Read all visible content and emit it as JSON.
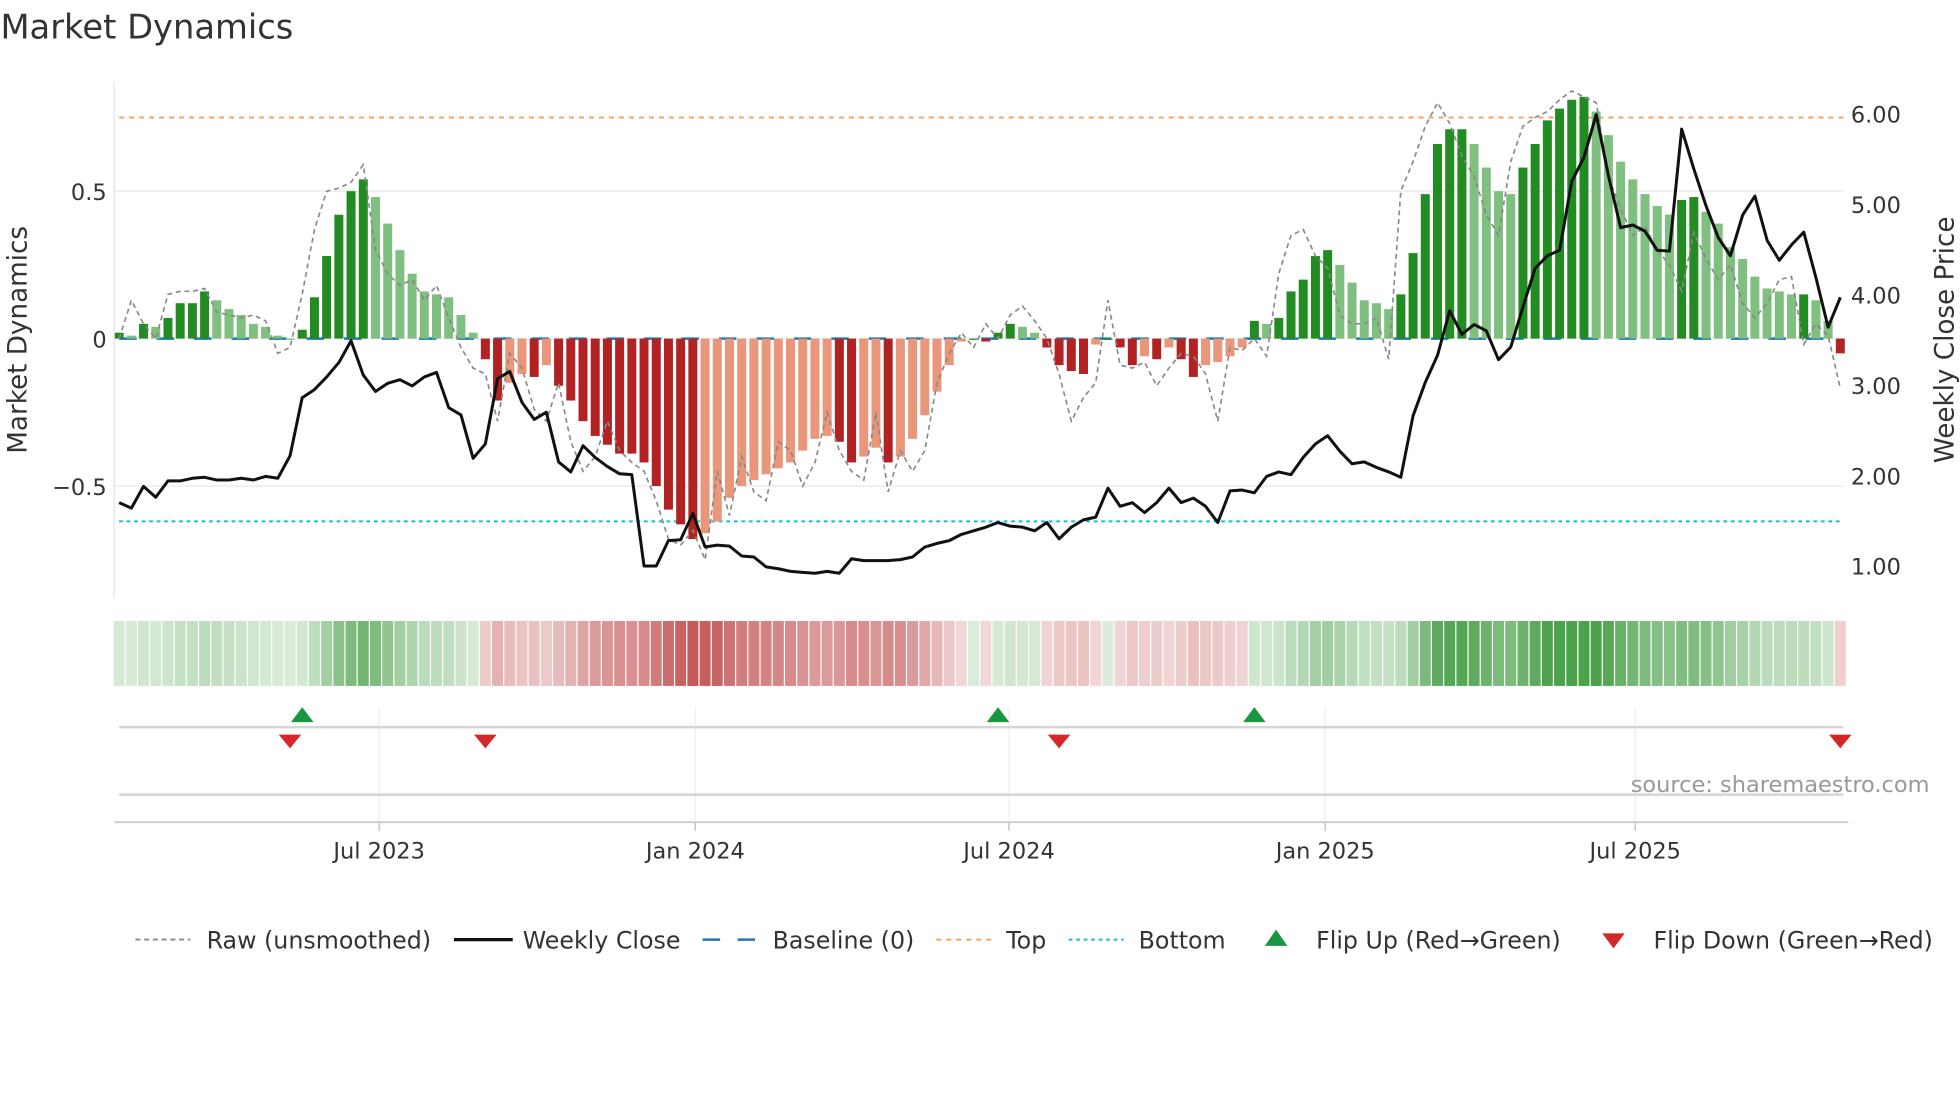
{
  "chart_data": {
    "type": "bar",
    "title": "Market Dynamics",
    "ylabel_left": "Market Dynamics",
    "ylabel_right": "Weekly Close Price",
    "source": "source: sharemaestro.com",
    "x_unit": "week index",
    "x_ticks": [
      {
        "label": "Jul 2023",
        "week": 21.3
      },
      {
        "label": "Jan 2024",
        "week": 47.2
      },
      {
        "label": "Jul 2024",
        "week": 72.9
      },
      {
        "label": "Jan 2025",
        "week": 98.8
      },
      {
        "label": "Jul 2025",
        "week": 124.2
      }
    ],
    "left_axis": {
      "ylim": [
        -0.88,
        0.88
      ],
      "ticks": [
        {
          "v": 0.5,
          "label": "0.5"
        },
        {
          "v": 0,
          "label": "0"
        },
        {
          "v": -0.5,
          "label": "−0.5"
        }
      ]
    },
    "right_axis": {
      "ylim": [
        0.5,
        6.5
      ],
      "ticks": [
        {
          "v": 6,
          "label": "6.00"
        },
        {
          "v": 5,
          "label": "5.00"
        },
        {
          "v": 4,
          "label": "4.00"
        },
        {
          "v": 3,
          "label": "3.00"
        },
        {
          "v": 2,
          "label": "2.00"
        },
        {
          "v": 1,
          "label": "1.00"
        }
      ]
    },
    "top_level": 0.75,
    "bottom_level": -0.62,
    "baseline": 0,
    "series": [
      {
        "name": "Market Dynamics (smoothed)",
        "values": [
          0.02,
          0.01,
          0.05,
          0.04,
          0.07,
          0.12,
          0.12,
          0.16,
          0.13,
          0.1,
          0.08,
          0.05,
          0.04,
          0.01,
          0.0,
          0.03,
          0.14,
          0.28,
          0.42,
          0.5,
          0.54,
          0.48,
          0.39,
          0.3,
          0.22,
          0.16,
          0.15,
          0.14,
          0.08,
          0.02,
          -0.07,
          -0.21,
          -0.15,
          -0.12,
          -0.13,
          -0.09,
          -0.16,
          -0.21,
          -0.28,
          -0.33,
          -0.36,
          -0.39,
          -0.39,
          -0.42,
          -0.5,
          -0.58,
          -0.63,
          -0.68,
          -0.66,
          -0.62,
          -0.54,
          -0.5,
          -0.48,
          -0.46,
          -0.44,
          -0.42,
          -0.38,
          -0.34,
          -0.33,
          -0.35,
          -0.42,
          -0.4,
          -0.37,
          -0.42,
          -0.4,
          -0.34,
          -0.26,
          -0.18,
          -0.09,
          -0.01,
          0.0,
          -0.01,
          0.02,
          0.05,
          0.04,
          0.02,
          -0.03,
          -0.09,
          -0.11,
          -0.12,
          -0.02,
          0.0,
          -0.03,
          -0.09,
          -0.06,
          -0.07,
          -0.03,
          -0.07,
          -0.13,
          -0.09,
          -0.08,
          -0.06,
          -0.03,
          0.06,
          0.05,
          0.07,
          0.16,
          0.2,
          0.28,
          0.3,
          0.25,
          0.19,
          0.13,
          0.12,
          0.1,
          0.15,
          0.29,
          0.49,
          0.66,
          0.71,
          0.71,
          0.66,
          0.58,
          0.5,
          0.49,
          0.58,
          0.66,
          0.74,
          0.78,
          0.81,
          0.82,
          0.77,
          0.69,
          0.6,
          0.54,
          0.49,
          0.45,
          0.42,
          0.47,
          0.48,
          0.43,
          0.39,
          0.31,
          0.27,
          0.21,
          0.17,
          0.16,
          0.15,
          0.15,
          0.13,
          0.06,
          -0.05
        ]
      },
      {
        "name": "Raw (unsmoothed)",
        "values": [
          0.0,
          0.13,
          0.05,
          0.0,
          0.15,
          0.16,
          0.16,
          0.17,
          0.09,
          0.08,
          0.07,
          0.08,
          0.06,
          -0.05,
          -0.03,
          0.15,
          0.37,
          0.5,
          0.51,
          0.53,
          0.59,
          0.3,
          0.22,
          0.18,
          0.2,
          0.13,
          0.18,
          0.07,
          -0.03,
          -0.1,
          -0.12,
          -0.28,
          -0.05,
          -0.1,
          -0.24,
          -0.28,
          -0.15,
          -0.35,
          -0.45,
          -0.4,
          -0.28,
          -0.38,
          -0.42,
          -0.45,
          -0.55,
          -0.68,
          -0.7,
          -0.65,
          -0.75,
          -0.45,
          -0.6,
          -0.4,
          -0.52,
          -0.55,
          -0.35,
          -0.38,
          -0.5,
          -0.42,
          -0.25,
          -0.38,
          -0.45,
          -0.48,
          -0.25,
          -0.52,
          -0.38,
          -0.45,
          -0.38,
          -0.15,
          -0.05,
          0.02,
          -0.03,
          0.05,
          0.0,
          0.08,
          0.11,
          0.06,
          0.0,
          -0.12,
          -0.28,
          -0.2,
          -0.15,
          0.13,
          -0.09,
          -0.1,
          -0.08,
          -0.16,
          -0.1,
          -0.05,
          -0.06,
          -0.12,
          -0.28,
          -0.03,
          -0.04,
          0.0,
          -0.06,
          0.22,
          0.35,
          0.37,
          0.28,
          0.24,
          0.08,
          0.05,
          0.05,
          0.07,
          -0.07,
          0.5,
          0.6,
          0.72,
          0.8,
          0.73,
          0.62,
          0.55,
          0.42,
          0.35,
          0.6,
          0.72,
          0.75,
          0.77,
          0.81,
          0.84,
          0.82,
          0.8,
          0.55,
          0.44,
          0.35,
          0.38,
          0.3,
          0.25,
          0.16,
          0.36,
          0.27,
          0.2,
          0.25,
          0.12,
          0.07,
          0.12,
          0.2,
          0.21,
          -0.02,
          0.05,
          0.01,
          -0.17
        ]
      },
      {
        "name": "Weekly Close",
        "axis": "right",
        "values": [
          1.7,
          1.64,
          1.88,
          1.76,
          1.94,
          1.94,
          1.97,
          1.98,
          1.95,
          1.95,
          1.97,
          1.95,
          1.99,
          1.97,
          2.22,
          2.86,
          2.95,
          3.09,
          3.25,
          3.49,
          3.11,
          2.93,
          3.02,
          3.06,
          2.99,
          3.09,
          3.14,
          2.75,
          2.67,
          2.19,
          2.35,
          3.07,
          3.15,
          2.81,
          2.62,
          2.7,
          2.15,
          2.04,
          2.33,
          2.2,
          2.1,
          2.02,
          2.01,
          1.0,
          1.0,
          1.28,
          1.29,
          1.58,
          1.21,
          1.23,
          1.22,
          1.11,
          1.1,
          0.99,
          0.97,
          0.94,
          0.93,
          0.92,
          0.94,
          0.92,
          1.08,
          1.06,
          1.06,
          1.06,
          1.07,
          1.1,
          1.21,
          1.25,
          1.28,
          1.35,
          1.39,
          1.43,
          1.48,
          1.44,
          1.43,
          1.39,
          1.48,
          1.3,
          1.43,
          1.51,
          1.54,
          1.86,
          1.66,
          1.7,
          1.59,
          1.7,
          1.86,
          1.7,
          1.75,
          1.66,
          1.48,
          1.83,
          1.84,
          1.81,
          1.99,
          2.04,
          2.01,
          2.2,
          2.35,
          2.44,
          2.27,
          2.13,
          2.15,
          2.09,
          2.04,
          1.98,
          2.66,
          3.03,
          3.33,
          3.82,
          3.56,
          3.67,
          3.6,
          3.28,
          3.42,
          3.86,
          4.29,
          4.43,
          4.49,
          5.25,
          5.52,
          5.99,
          5.32,
          4.74,
          4.77,
          4.7,
          4.49,
          4.48,
          5.83,
          5.39,
          4.98,
          4.63,
          4.43,
          4.88,
          5.09,
          4.6,
          4.38,
          4.55,
          4.69,
          4.19,
          3.64,
          3.97
        ]
      }
    ],
    "flip_up_weeks": [
      15,
      72,
      93
    ],
    "flip_down_weeks": [
      14,
      30,
      77,
      141
    ],
    "legend": {
      "placement": "bottom",
      "entries": [
        "Raw (unsmoothed)",
        "Weekly Close",
        "Baseline (0)",
        "Top",
        "Bottom",
        "Flip Up (Red→Green)",
        "Flip Down (Green→Red)"
      ]
    },
    "colors": {
      "up_strong": "#228b22",
      "up_weak": "#7fbf7f",
      "down_strong": "#b22222",
      "down_weak": "#e9967a",
      "price": "#111111",
      "raw": "#888888",
      "baseline": "#1f77b4",
      "top": "#f4a460",
      "bottom": "#17becf",
      "flip_up": "#1a9641",
      "flip_down": "#d62728"
    }
  }
}
